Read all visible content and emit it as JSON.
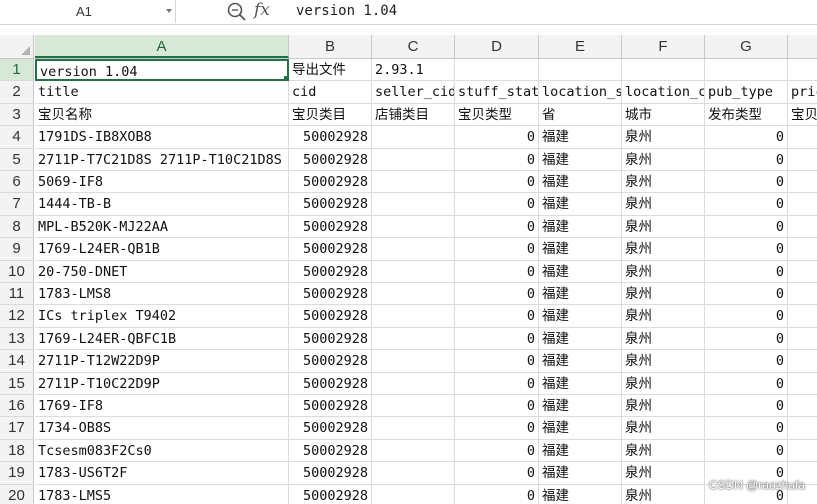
{
  "formula_bar": {
    "cell_ref": "A1",
    "fx_label": "fx",
    "content": "version 1.04"
  },
  "columns": [
    "A",
    "B",
    "C",
    "D",
    "E",
    "F",
    "G",
    ""
  ],
  "active_column": "A",
  "rows": [
    {
      "num": "1",
      "cells": [
        "version 1.04",
        "导出文件",
        "2.93.1",
        "",
        "",
        "",
        "",
        ""
      ]
    },
    {
      "num": "2",
      "cells": [
        "title",
        "cid",
        "seller_cids",
        "stuff_status",
        "location_state",
        "location_city",
        "pub_type",
        "price"
      ]
    },
    {
      "num": "3",
      "cells": [
        "宝贝名称",
        "宝贝类目",
        "店铺类目",
        "宝贝类型",
        "省",
        "城市",
        "发布类型",
        "宝贝"
      ]
    },
    {
      "num": "4",
      "cells": [
        "1791DS-IB8XOB8",
        "50002928",
        "",
        "0",
        "福建",
        "泉州",
        "0",
        ""
      ]
    },
    {
      "num": "5",
      "cells": [
        "2711P-T7C21D8S 2711P-T10C21D8S",
        "50002928",
        "",
        "0",
        "福建",
        "泉州",
        "0",
        ""
      ]
    },
    {
      "num": "6",
      "cells": [
        "5069-IF8",
        "50002928",
        "",
        "0",
        "福建",
        "泉州",
        "0",
        ""
      ]
    },
    {
      "num": "7",
      "cells": [
        "1444-TB-B",
        "50002928",
        "",
        "0",
        "福建",
        "泉州",
        "0",
        ""
      ]
    },
    {
      "num": "8",
      "cells": [
        "MPL-B520K-MJ22AA",
        "50002928",
        "",
        "0",
        "福建",
        "泉州",
        "0",
        ""
      ]
    },
    {
      "num": "9",
      "cells": [
        "1769-L24ER-QB1B",
        "50002928",
        "",
        "0",
        "福建",
        "泉州",
        "0",
        ""
      ]
    },
    {
      "num": "10",
      "cells": [
        "20-750-DNET",
        "50002928",
        "",
        "0",
        "福建",
        "泉州",
        "0",
        ""
      ]
    },
    {
      "num": "11",
      "cells": [
        "1783-LMS8",
        "50002928",
        "",
        "0",
        "福建",
        "泉州",
        "0",
        ""
      ]
    },
    {
      "num": "12",
      "cells": [
        "ICs triplex T9402",
        "50002928",
        "",
        "0",
        "福建",
        "泉州",
        "0",
        ""
      ]
    },
    {
      "num": "13",
      "cells": [
        "1769-L24ER-QBFC1B",
        "50002928",
        "",
        "0",
        "福建",
        "泉州",
        "0",
        ""
      ]
    },
    {
      "num": "14",
      "cells": [
        "2711P-T12W22D9P",
        "50002928",
        "",
        "0",
        "福建",
        "泉州",
        "0",
        ""
      ]
    },
    {
      "num": "15",
      "cells": [
        "2711P-T10C22D9P",
        "50002928",
        "",
        "0",
        "福建",
        "泉州",
        "0",
        ""
      ]
    },
    {
      "num": "16",
      "cells": [
        "1769-IF8",
        "50002928",
        "",
        "0",
        "福建",
        "泉州",
        "0",
        ""
      ]
    },
    {
      "num": "17",
      "cells": [
        "1734-OB8S",
        "50002928",
        "",
        "0",
        "福建",
        "泉州",
        "0",
        ""
      ]
    },
    {
      "num": "18",
      "cells": [
        "Tcsesm083F2Cs0",
        "50002928",
        "",
        "0",
        "福建",
        "泉州",
        "0",
        ""
      ]
    },
    {
      "num": "19",
      "cells": [
        "1783-US6T2F",
        "50002928",
        "",
        "0",
        "福建",
        "泉州",
        "0",
        ""
      ]
    },
    {
      "num": "20",
      "cells": [
        "1783-LMS5",
        "50002928",
        "",
        "0",
        "福建",
        "泉州",
        "0",
        ""
      ]
    }
  ],
  "watermark": "CSDN @raozhufa"
}
